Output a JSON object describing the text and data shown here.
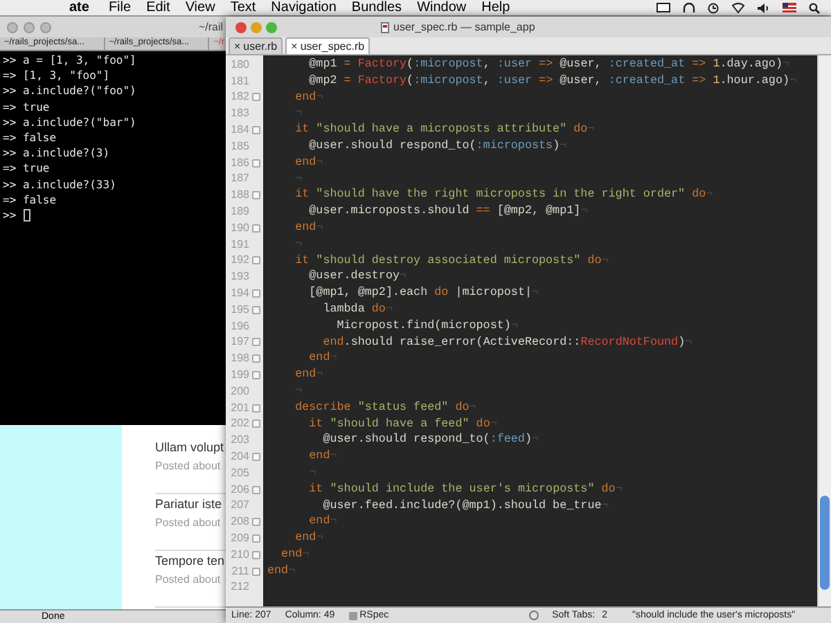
{
  "menu_bar": {
    "app": "ate",
    "items": [
      "File",
      "Edit",
      "View",
      "Text",
      "Navigation",
      "Bundles",
      "Window",
      "Help"
    ]
  },
  "terminal": {
    "title": "~/rail",
    "tabs": [
      "~/rails_projects/sa...",
      "~/rails_projects/sa...",
      "~/r"
    ],
    "lines": [
      ">> a = [1, 3, \"foo\"]",
      "=> [1, 3, \"foo\"]",
      ">> a.include?(\"foo\")",
      "=> true",
      ">> a.include?(\"bar\")",
      "=> false",
      ">> a.include?(3)",
      "=> true",
      ">> a.include?(33)",
      "=> false",
      ">>"
    ],
    "cursor_visible": true
  },
  "browser": {
    "posts": [
      {
        "title": "Ullam volupt",
        "meta": "Posted about"
      },
      {
        "title": "Pariatur iste",
        "meta": "Posted about"
      },
      {
        "title": "Tempore ten",
        "meta": "Posted about"
      }
    ],
    "status": "Done"
  },
  "editor": {
    "title": "user_spec.rb — sample_app",
    "close_glyph": "×",
    "tabs": [
      {
        "label": "user.rb",
        "selected": false
      },
      {
        "label": "user_spec.rb",
        "selected": true
      }
    ],
    "lines": [
      {
        "number": "180",
        "fold": false,
        "tokens": [
          {
            "kind": "plain",
            "text": "      @mp1"
          },
          {
            "kind": "keyword",
            "text": " ="
          },
          {
            "kind": "constant",
            "text": " Factory"
          },
          {
            "kind": "plain",
            "text": "("
          },
          {
            "kind": "symbol",
            "text": ":micropost"
          },
          {
            "kind": "plain",
            "text": ","
          },
          {
            "kind": "symbol",
            "text": " :user"
          },
          {
            "kind": "keyword",
            "text": " =>"
          },
          {
            "kind": "plain",
            "text": " @user,"
          },
          {
            "kind": "symbol",
            "text": " :created_at"
          },
          {
            "kind": "keyword",
            "text": " =>"
          },
          {
            "kind": "number",
            "text": " 1"
          },
          {
            "kind": "plain",
            "text": ".day.ago)"
          },
          {
            "kind": "invisible",
            "text": "¬"
          }
        ]
      },
      {
        "number": "181",
        "fold": false,
        "tokens": [
          {
            "kind": "plain",
            "text": "      @mp2"
          },
          {
            "kind": "keyword",
            "text": " ="
          },
          {
            "kind": "constant",
            "text": " Factory"
          },
          {
            "kind": "plain",
            "text": "("
          },
          {
            "kind": "symbol",
            "text": ":micropost"
          },
          {
            "kind": "plain",
            "text": ","
          },
          {
            "kind": "symbol",
            "text": " :user"
          },
          {
            "kind": "keyword",
            "text": " =>"
          },
          {
            "kind": "plain",
            "text": " @user,"
          },
          {
            "kind": "symbol",
            "text": " :created_at"
          },
          {
            "kind": "keyword",
            "text": " =>"
          },
          {
            "kind": "number",
            "text": " 1"
          },
          {
            "kind": "plain",
            "text": ".hour.ago)"
          },
          {
            "kind": "invisible",
            "text": "¬"
          }
        ]
      },
      {
        "number": "182",
        "fold": true,
        "tokens": [
          {
            "kind": "keyword",
            "text": "    end"
          },
          {
            "kind": "invisible",
            "text": "¬"
          }
        ]
      },
      {
        "number": "183",
        "fold": false,
        "tokens": [
          {
            "kind": "invisible",
            "text": "    ¬"
          }
        ]
      },
      {
        "number": "184",
        "fold": true,
        "tokens": [
          {
            "kind": "keyword",
            "text": "    it"
          },
          {
            "kind": "string",
            "text": " \"should have a microposts attribute\""
          },
          {
            "kind": "keyword",
            "text": " do"
          },
          {
            "kind": "invisible",
            "text": "¬"
          }
        ]
      },
      {
        "number": "185",
        "fold": false,
        "tokens": [
          {
            "kind": "plain",
            "text": "      @user.should respond_to("
          },
          {
            "kind": "symbol",
            "text": ":microposts"
          },
          {
            "kind": "plain",
            "text": ")"
          },
          {
            "kind": "invisible",
            "text": "¬"
          }
        ]
      },
      {
        "number": "186",
        "fold": true,
        "tokens": [
          {
            "kind": "keyword",
            "text": "    end"
          },
          {
            "kind": "invisible",
            "text": "¬"
          }
        ]
      },
      {
        "number": "187",
        "fold": false,
        "tokens": [
          {
            "kind": "invisible",
            "text": "    ¬"
          }
        ]
      },
      {
        "number": "188",
        "fold": true,
        "tokens": [
          {
            "kind": "keyword",
            "text": "    it"
          },
          {
            "kind": "string",
            "text": " \"should have the right microposts in the right order\""
          },
          {
            "kind": "keyword",
            "text": " do"
          },
          {
            "kind": "invisible",
            "text": "¬"
          }
        ]
      },
      {
        "number": "189",
        "fold": false,
        "tokens": [
          {
            "kind": "plain",
            "text": "      @user.microposts.should"
          },
          {
            "kind": "keyword",
            "text": " =="
          },
          {
            "kind": "plain",
            "text": " [@mp2, @mp1]"
          },
          {
            "kind": "invisible",
            "text": "¬"
          }
        ]
      },
      {
        "number": "190",
        "fold": true,
        "tokens": [
          {
            "kind": "keyword",
            "text": "    end"
          },
          {
            "kind": "invisible",
            "text": "¬"
          }
        ]
      },
      {
        "number": "191",
        "fold": false,
        "tokens": [
          {
            "kind": "invisible",
            "text": "    ¬"
          }
        ]
      },
      {
        "number": "192",
        "fold": true,
        "tokens": [
          {
            "kind": "keyword",
            "text": "    it"
          },
          {
            "kind": "string",
            "text": " \"should destroy associated microposts\""
          },
          {
            "kind": "keyword",
            "text": " do"
          },
          {
            "kind": "invisible",
            "text": "¬"
          }
        ]
      },
      {
        "number": "193",
        "fold": false,
        "tokens": [
          {
            "kind": "plain",
            "text": "      @user.destroy"
          },
          {
            "kind": "invisible",
            "text": "¬"
          }
        ]
      },
      {
        "number": "194",
        "fold": true,
        "tokens": [
          {
            "kind": "plain",
            "text": "      [@mp1, @mp2].each"
          },
          {
            "kind": "keyword",
            "text": " do"
          },
          {
            "kind": "plain",
            "text": " |micropost|"
          },
          {
            "kind": "invisible",
            "text": "¬"
          }
        ]
      },
      {
        "number": "195",
        "fold": true,
        "tokens": [
          {
            "kind": "plain",
            "text": "        lambda"
          },
          {
            "kind": "keyword",
            "text": " do"
          },
          {
            "kind": "invisible",
            "text": "¬"
          }
        ]
      },
      {
        "number": "196",
        "fold": false,
        "tokens": [
          {
            "kind": "plain",
            "text": "          Micropost.find(micropost)"
          },
          {
            "kind": "invisible",
            "text": "¬"
          }
        ]
      },
      {
        "number": "197",
        "fold": true,
        "tokens": [
          {
            "kind": "keyword",
            "text": "        end"
          },
          {
            "kind": "plain",
            "text": ".should raise_error(ActiveRecord::"
          },
          {
            "kind": "constant",
            "text": "RecordNotFound"
          },
          {
            "kind": "plain",
            "text": ")"
          },
          {
            "kind": "invisible",
            "text": "¬"
          }
        ]
      },
      {
        "number": "198",
        "fold": true,
        "tokens": [
          {
            "kind": "keyword",
            "text": "      end"
          },
          {
            "kind": "invisible",
            "text": "¬"
          }
        ]
      },
      {
        "number": "199",
        "fold": true,
        "tokens": [
          {
            "kind": "keyword",
            "text": "    end"
          },
          {
            "kind": "invisible",
            "text": "¬"
          }
        ]
      },
      {
        "number": "200",
        "fold": false,
        "tokens": [
          {
            "kind": "invisible",
            "text": "    ¬"
          }
        ]
      },
      {
        "number": "201",
        "fold": true,
        "tokens": [
          {
            "kind": "keyword",
            "text": "    describe"
          },
          {
            "kind": "string",
            "text": " \"status feed\""
          },
          {
            "kind": "keyword",
            "text": " do"
          },
          {
            "kind": "invisible",
            "text": "¬"
          }
        ]
      },
      {
        "number": "202",
        "fold": true,
        "tokens": [
          {
            "kind": "keyword",
            "text": "      it"
          },
          {
            "kind": "string",
            "text": " \"should have a feed\""
          },
          {
            "kind": "keyword",
            "text": " do"
          },
          {
            "kind": "invisible",
            "text": "¬"
          }
        ]
      },
      {
        "number": "203",
        "fold": false,
        "tokens": [
          {
            "kind": "plain",
            "text": "        @user.should respond_to("
          },
          {
            "kind": "symbol",
            "text": ":feed"
          },
          {
            "kind": "plain",
            "text": ")"
          },
          {
            "kind": "invisible",
            "text": "¬"
          }
        ]
      },
      {
        "number": "204",
        "fold": true,
        "tokens": [
          {
            "kind": "keyword",
            "text": "      end"
          },
          {
            "kind": "invisible",
            "text": "¬"
          }
        ]
      },
      {
        "number": "205",
        "fold": false,
        "tokens": [
          {
            "kind": "invisible",
            "text": "      ¬"
          }
        ]
      },
      {
        "number": "206",
        "fold": true,
        "tokens": [
          {
            "kind": "keyword",
            "text": "      it"
          },
          {
            "kind": "string",
            "text": " \"should include the user's microposts\""
          },
          {
            "kind": "keyword",
            "text": " do"
          },
          {
            "kind": "invisible",
            "text": "¬"
          }
        ]
      },
      {
        "number": "207",
        "fold": false,
        "tokens": [
          {
            "kind": "plain",
            "text": "        @user.feed.include?(@mp1).should be_true"
          },
          {
            "kind": "invisible",
            "text": "¬"
          }
        ]
      },
      {
        "number": "208",
        "fold": true,
        "tokens": [
          {
            "kind": "keyword",
            "text": "      end"
          },
          {
            "kind": "invisible",
            "text": "¬"
          }
        ]
      },
      {
        "number": "209",
        "fold": true,
        "tokens": [
          {
            "kind": "keyword",
            "text": "    end"
          },
          {
            "kind": "invisible",
            "text": "¬"
          }
        ]
      },
      {
        "number": "210",
        "fold": true,
        "tokens": [
          {
            "kind": "keyword",
            "text": "  end"
          },
          {
            "kind": "invisible",
            "text": "¬"
          }
        ]
      },
      {
        "number": "211",
        "fold": true,
        "tokens": [
          {
            "kind": "keyword",
            "text": "end"
          },
          {
            "kind": "invisible",
            "text": "¬"
          }
        ]
      },
      {
        "number": "212",
        "fold": false
      }
    ],
    "status_bar": {
      "line": "Line: 207",
      "column": "Column: 49",
      "language": "RSpec",
      "soft_tabs": "Soft Tabs:",
      "tab_size": "2",
      "symbol": "\"should include the user's microposts\""
    }
  }
}
